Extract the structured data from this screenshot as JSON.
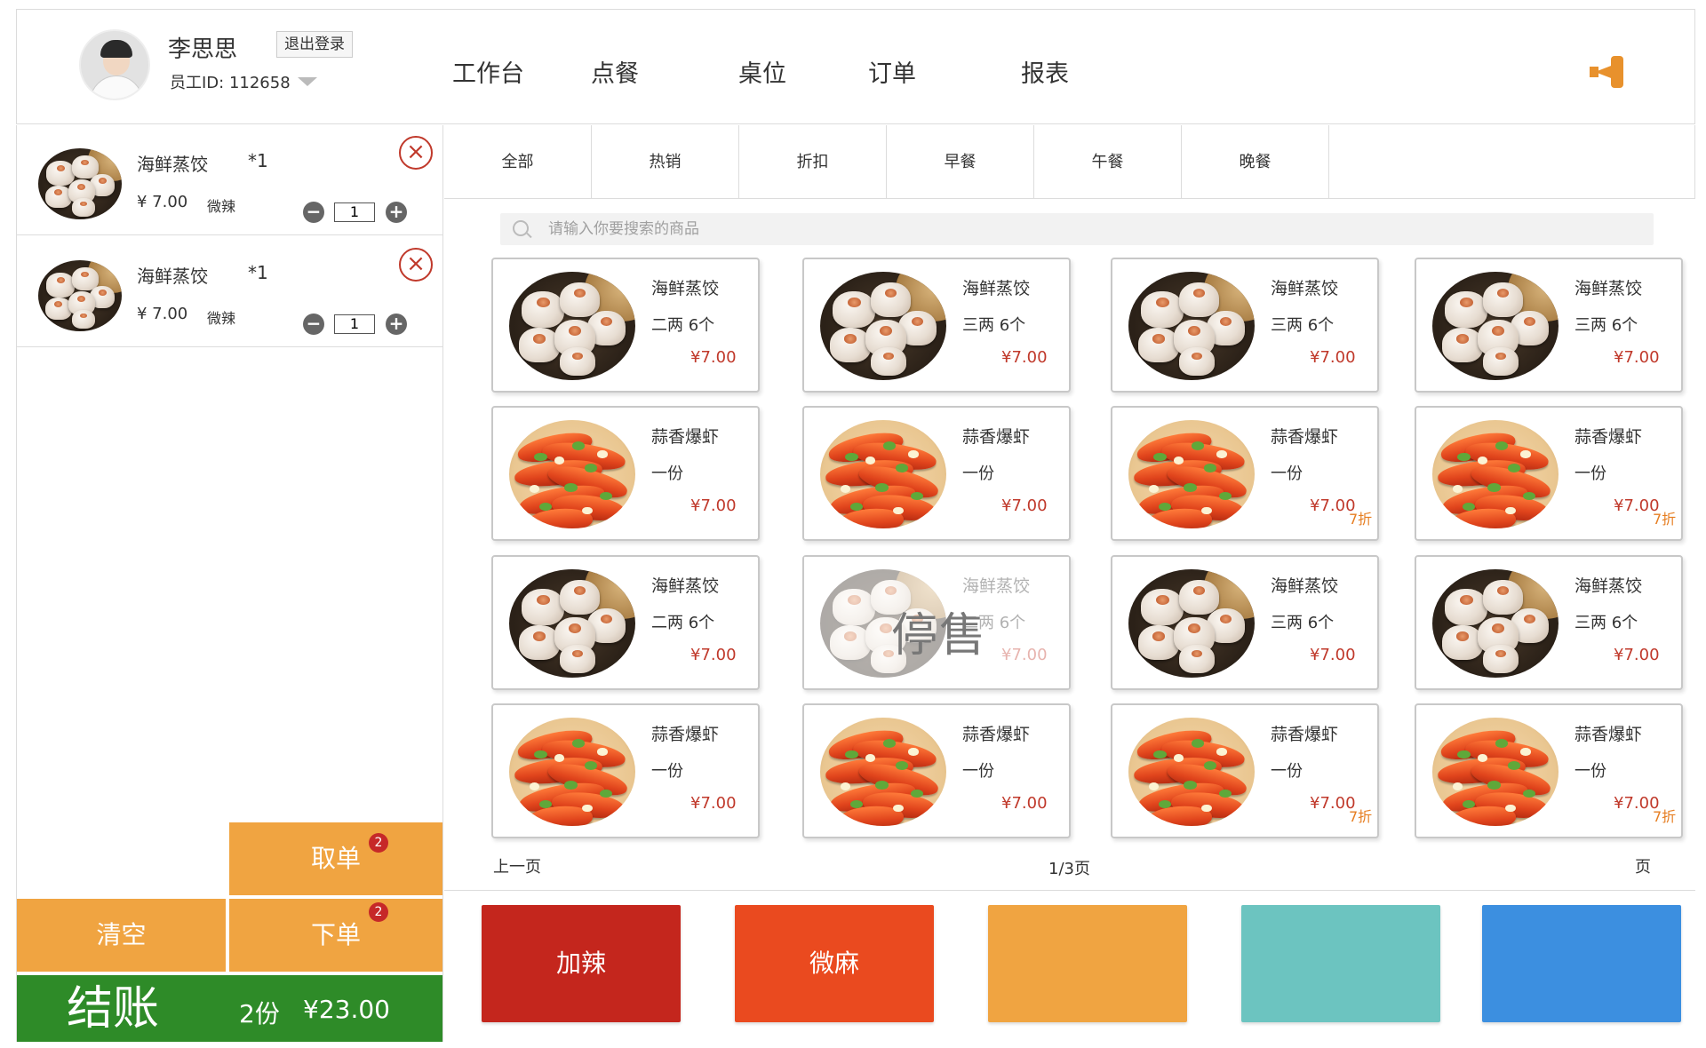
{
  "header": {
    "user_name": "李思思",
    "logout_label": "退出登录",
    "employee_id_label": "员工ID: 112658",
    "nav": [
      "工作台",
      "点餐",
      "桌位",
      "订单",
      "报表"
    ],
    "notice_icon": "megaphone-icon",
    "accent_color": "#e8912c"
  },
  "cart": {
    "items": [
      {
        "name": "海鲜蒸饺",
        "qty_tag": "*1",
        "price": "¥ 7.00",
        "taste": "微辣",
        "quantity": "1"
      },
      {
        "name": "海鲜蒸饺",
        "qty_tag": "*1",
        "price": "¥ 7.00",
        "taste": "微辣",
        "quantity": "1"
      }
    ],
    "fetch_label": "取单",
    "fetch_badge": "2",
    "clear_label": "清空",
    "order_label": "下单",
    "order_badge": "2",
    "checkout_label": "结账",
    "checkout_count": "2份",
    "checkout_total": "¥23.00"
  },
  "tabs": [
    "全部",
    "热销",
    "折扣",
    "早餐",
    "午餐",
    "晚餐"
  ],
  "search": {
    "placeholder": "请输入你要搜索的商品"
  },
  "products": [
    {
      "kind": "dumpling",
      "name": "海鲜蒸饺",
      "spec": "二两 6个",
      "price": "¥7.00",
      "discount": "",
      "soldout": ""
    },
    {
      "kind": "dumpling",
      "name": "海鲜蒸饺",
      "spec": "三两 6个",
      "price": "¥7.00",
      "discount": "",
      "soldout": ""
    },
    {
      "kind": "dumpling",
      "name": "海鲜蒸饺",
      "spec": "三两 6个",
      "price": "¥7.00",
      "discount": "",
      "soldout": ""
    },
    {
      "kind": "dumpling",
      "name": "海鲜蒸饺",
      "spec": "三两 6个",
      "price": "¥7.00",
      "discount": "",
      "soldout": ""
    },
    {
      "kind": "shrimp",
      "name": "蒜香爆虾",
      "spec": "一份",
      "price": "¥7.00",
      "discount": "",
      "soldout": ""
    },
    {
      "kind": "shrimp",
      "name": "蒜香爆虾",
      "spec": "一份",
      "price": "¥7.00",
      "discount": "",
      "soldout": ""
    },
    {
      "kind": "shrimp",
      "name": "蒜香爆虾",
      "spec": "一份",
      "price": "¥7.00",
      "discount": "7折",
      "soldout": ""
    },
    {
      "kind": "shrimp",
      "name": "蒜香爆虾",
      "spec": "一份",
      "price": "¥7.00",
      "discount": "7折",
      "soldout": ""
    },
    {
      "kind": "dumpling",
      "name": "海鲜蒸饺",
      "spec": "二两 6个",
      "price": "¥7.00",
      "discount": "",
      "soldout": ""
    },
    {
      "kind": "dumpling",
      "name": "海鲜蒸饺",
      "spec": "二两 6个",
      "price": "¥7.00",
      "discount": "",
      "soldout": "停售"
    },
    {
      "kind": "dumpling",
      "name": "海鲜蒸饺",
      "spec": "三两 6个",
      "price": "¥7.00",
      "discount": "",
      "soldout": ""
    },
    {
      "kind": "dumpling",
      "name": "海鲜蒸饺",
      "spec": "三两 6个",
      "price": "¥7.00",
      "discount": "",
      "soldout": ""
    },
    {
      "kind": "shrimp",
      "name": "蒜香爆虾",
      "spec": "一份",
      "price": "¥7.00",
      "discount": "",
      "soldout": ""
    },
    {
      "kind": "shrimp",
      "name": "蒜香爆虾",
      "spec": "一份",
      "price": "¥7.00",
      "discount": "",
      "soldout": ""
    },
    {
      "kind": "shrimp",
      "name": "蒜香爆虾",
      "spec": "一份",
      "price": "¥7.00",
      "discount": "7折",
      "soldout": ""
    },
    {
      "kind": "shrimp",
      "name": "蒜香爆虾",
      "spec": "一份",
      "price": "¥7.00",
      "discount": "7折",
      "soldout": ""
    }
  ],
  "pager": {
    "prev_label": "上一页",
    "info": "1/3页",
    "next_label": "页"
  },
  "tastes": [
    {
      "label": "加辣",
      "color": "#c4261d"
    },
    {
      "label": "微麻",
      "color": "#ea4a1f"
    },
    {
      "label": "",
      "color": "#f0a441"
    },
    {
      "label": "",
      "color": "#6cc4c0"
    },
    {
      "label": "",
      "color": "#3c8fe0"
    }
  ]
}
